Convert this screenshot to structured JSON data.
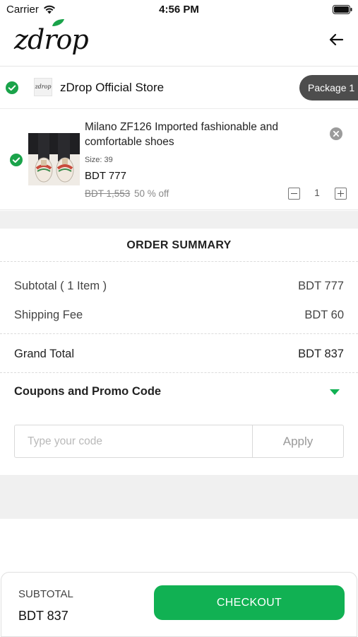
{
  "status_bar": {
    "carrier": "Carrier",
    "time": "4:56 PM"
  },
  "header": {
    "logo_text": "zdrop",
    "logo_icon": "leaf-icon",
    "back_icon": "arrow-left-icon"
  },
  "store": {
    "selected": true,
    "logo_text": "zdrop",
    "name": "zDrop Official Store",
    "package_label": "Package 1"
  },
  "cart_item": {
    "selected": true,
    "title": "Milano ZF126 Imported fashionable and comfortable shoes",
    "size": "Size: 39",
    "price": "BDT 777",
    "old_price": "BDT 1,553",
    "discount": "50 % off",
    "quantity": "1",
    "remove_icon": "close-circle-icon"
  },
  "order_summary": {
    "title": "ORDER SUMMARY",
    "subtotal_label": "Subtotal ( 1 Item )",
    "subtotal_value": "BDT 777",
    "shipping_label": "Shipping Fee",
    "shipping_value": "BDT 60",
    "grand_total_label": "Grand Total",
    "grand_total_value": "BDT 837"
  },
  "coupons": {
    "label": "Coupons and Promo Code",
    "input_placeholder": "Type your code",
    "input_value": "",
    "apply_label": "Apply"
  },
  "footer": {
    "subtotal_label": "SUBTOTAL",
    "subtotal_value": "BDT 837",
    "checkout_label": "CHECKOUT"
  },
  "colors": {
    "brand_green": "#11b153",
    "check_green": "#1aa34a",
    "pill_gray": "#4d4d4d"
  }
}
